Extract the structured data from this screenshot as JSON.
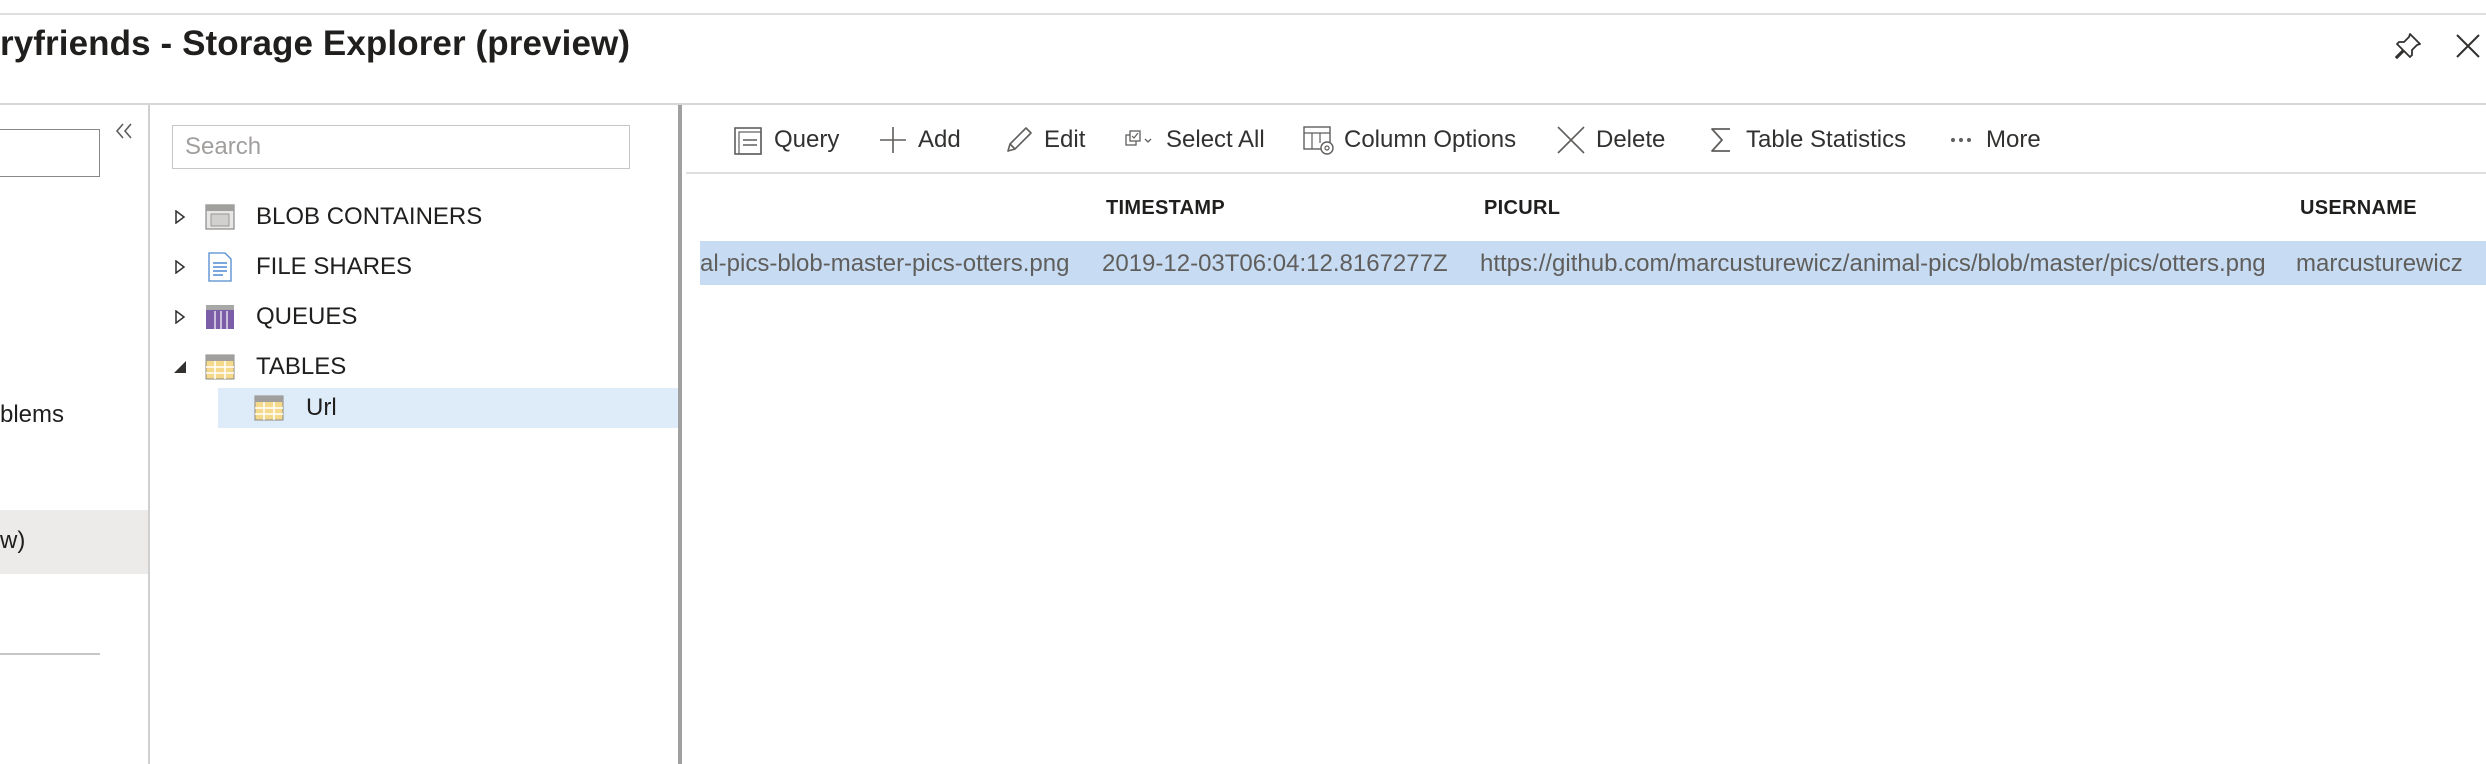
{
  "window": {
    "title": "ryfriends - Storage Explorer (preview)",
    "pin_icon": "pin-icon",
    "close_icon": "close-icon"
  },
  "left_nav": {
    "items": [
      {
        "label": "blems"
      },
      {
        "label": "w)",
        "selected": true
      }
    ],
    "collapse_icon": "double-chevron-left-icon"
  },
  "tree": {
    "search_placeholder": "Search",
    "nodes": [
      {
        "label": "BLOB CONTAINERS",
        "icon": "blob-containers-icon",
        "expanded": false
      },
      {
        "label": "FILE SHARES",
        "icon": "file-shares-icon",
        "expanded": false
      },
      {
        "label": "QUEUES",
        "icon": "queues-icon",
        "expanded": false
      },
      {
        "label": "TABLES",
        "icon": "tables-icon",
        "expanded": true,
        "children": [
          {
            "label": "Url",
            "icon": "table-icon",
            "selected": true
          }
        ]
      }
    ]
  },
  "toolbar": {
    "buttons": [
      {
        "label": "Query",
        "icon": "query-icon"
      },
      {
        "label": "Add",
        "icon": "add-icon"
      },
      {
        "label": "Edit",
        "icon": "edit-icon"
      },
      {
        "label": "Select All",
        "icon": "select-all-icon"
      },
      {
        "label": "Column Options",
        "icon": "column-options-icon"
      },
      {
        "label": "Delete",
        "icon": "delete-icon"
      },
      {
        "label": "Table Statistics",
        "icon": "sigma-icon"
      },
      {
        "label": "More",
        "icon": "more-icon"
      }
    ]
  },
  "table": {
    "columns": [
      "TIMESTAMP",
      "PICURL",
      "USERNAME"
    ],
    "rows": [
      {
        "rowkey": "al-pics-blob-master-pics-otters.png",
        "timestamp": "2019-12-03T06:04:12.8167277Z",
        "picurl": "https://github.com/marcusturewicz/animal-pics/blob/master/pics/otters.png",
        "username": "marcusturewicz",
        "selected": true
      }
    ]
  },
  "colors": {
    "selected_row": "#c7dcf2",
    "selected_tree_item": "#deecf9",
    "selected_nav_item": "#edebe9"
  }
}
